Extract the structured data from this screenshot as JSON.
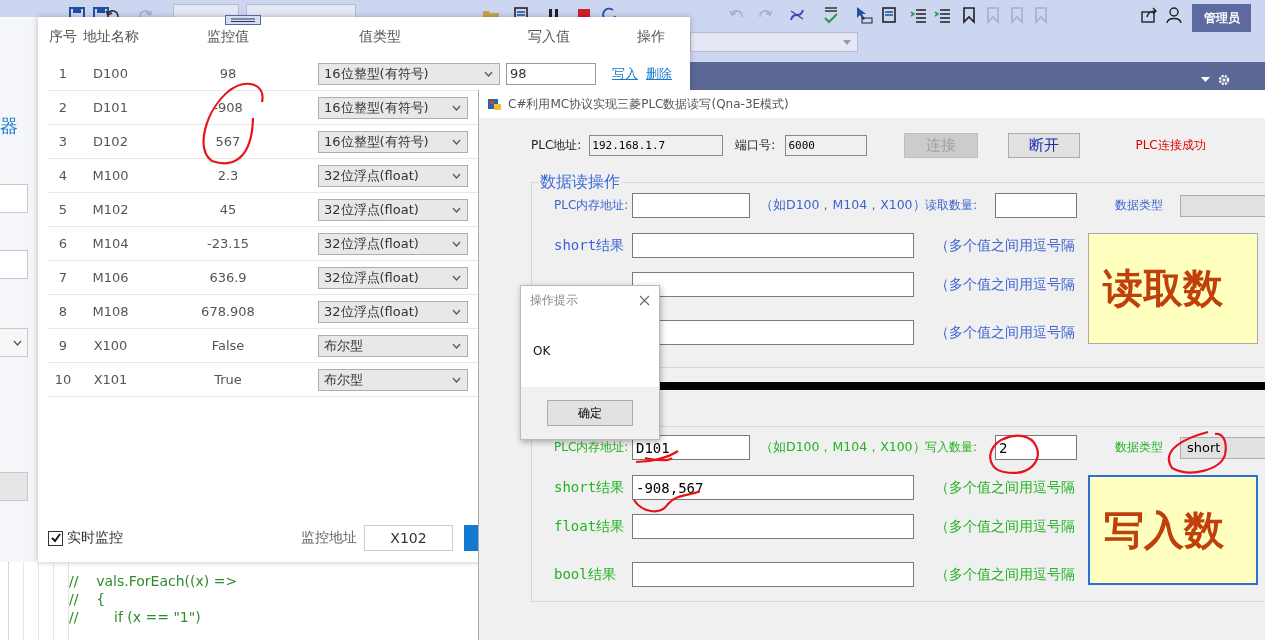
{
  "ide": {
    "account_button": "管理员",
    "code_lines": [
      "//    vals.ForEach((x) =>",
      "//    {",
      "//        if (x == \"1\")"
    ]
  },
  "back_form": {
    "heading_fragment": "器"
  },
  "monitor": {
    "columns": [
      "序号",
      "地址名称",
      "监控值",
      "值类型",
      "写入值",
      "操作"
    ],
    "rows": [
      {
        "index": "1",
        "address": "D100",
        "value": "98",
        "type": "16位整型(有符号)",
        "write_value": "98",
        "actions": [
          "写入",
          "删除"
        ]
      },
      {
        "index": "2",
        "address": "D101",
        "value": "-908",
        "type": "16位整型(有符号)"
      },
      {
        "index": "3",
        "address": "D102",
        "value": "567",
        "type": "16位整型(有符号)"
      },
      {
        "index": "4",
        "address": "M100",
        "value": "2.3",
        "type": "32位浮点(float)"
      },
      {
        "index": "5",
        "address": "M102",
        "value": "45",
        "type": "32位浮点(float)"
      },
      {
        "index": "6",
        "address": "M104",
        "value": "-23.15",
        "type": "32位浮点(float)"
      },
      {
        "index": "7",
        "address": "M106",
        "value": "636.9",
        "type": "32位浮点(float)"
      },
      {
        "index": "8",
        "address": "M108",
        "value": "678.908",
        "type": "32位浮点(float)"
      },
      {
        "index": "9",
        "address": "X100",
        "value": "False",
        "type": "布尔型"
      },
      {
        "index": "10",
        "address": "X101",
        "value": "True",
        "type": "布尔型"
      }
    ],
    "realtime": {
      "label": "实时监控",
      "checked": true
    },
    "address_label": "监控地址",
    "address_value": "X102"
  },
  "plc_window": {
    "title": "C#利用MC协议实现三菱PLC数据读写(Qna-3E模式)",
    "plc_address_label": "PLC地址:",
    "plc_address": "192.168.1.7",
    "port_label": "端口号:",
    "port": "6000",
    "buttons": [
      {
        "label": "连接",
        "disabled": true
      },
      {
        "label": "断开",
        "disabled": false
      }
    ],
    "status": "PLC连接成功",
    "read_group": {
      "title": "数据读操作",
      "address_label": "PLC内存地址:",
      "hint": "（如D100，M104，X100）",
      "count_label": "读取数量:",
      "type_label": "数据类型",
      "results": [
        {
          "label": "short结果",
          "hint": "（多个值之间用逗号隔"
        },
        {
          "hint": "（多个值之间用逗号隔"
        },
        {
          "hint": "（多个值之间用逗号隔"
        }
      ],
      "action": "读取数"
    },
    "write_group": {
      "address_label": "PLC内存地址:",
      "address": "D101",
      "hint": "（如D100，M104，X100）",
      "count_label": "写入数量:",
      "count": "2",
      "type_label": "数据类型",
      "data_type": "short",
      "results": [
        {
          "label": "short结果",
          "value": "-908,567",
          "hint": "（多个值之间用逗号隔"
        },
        {
          "label": "float结果",
          "hint": "（多个值之间用逗号隔"
        },
        {
          "label": "bool结果",
          "hint": "（多个值之间用逗号隔"
        }
      ],
      "action": "写入数"
    }
  },
  "dialog": {
    "title": "操作提示",
    "message": "OK",
    "button": "确定"
  }
}
